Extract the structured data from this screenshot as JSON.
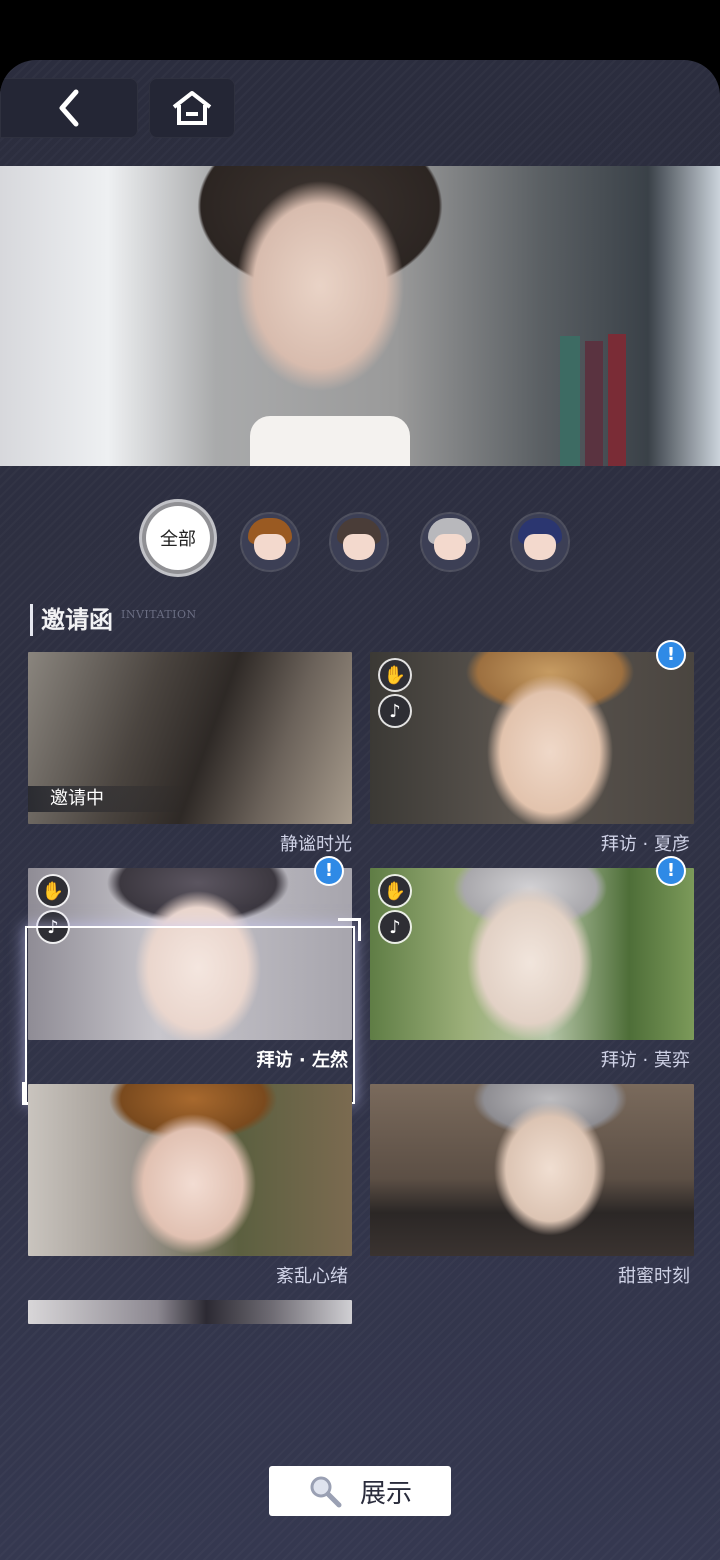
{
  "nav": {
    "back_icon": "chevron-left-icon",
    "home_icon": "home-icon"
  },
  "filters": {
    "all_label": "全部",
    "characters": [
      {
        "name": "character-filter-brown-hair",
        "hair_color": "#9a5a22"
      },
      {
        "name": "character-filter-dark-hair",
        "hair_color": "#4a3d38"
      },
      {
        "name": "character-filter-silver-hair",
        "hair_color": "#b8b8bc"
      },
      {
        "name": "character-filter-navy-hair",
        "hair_color": "#2b3670"
      }
    ]
  },
  "section": {
    "title": "邀请函",
    "subtitle": "INVITATION"
  },
  "cards": [
    {
      "caption": "静谧时光",
      "tag": "邀请中",
      "icons": [],
      "alert": false,
      "selected": false,
      "tone": [
        "#6b6660",
        "#3a3633",
        "#b2a697"
      ]
    },
    {
      "caption": "拜访 · 夏彦",
      "tag": "",
      "icons": [
        "hand-icon",
        "music-note-icon"
      ],
      "alert": true,
      "selected": false,
      "tone": [
        "#4a4540",
        "#c69b62",
        "#e8d3c2"
      ]
    },
    {
      "caption": "拜访 · 左然",
      "tag": "",
      "icons": [
        "hand-icon",
        "music-note-icon"
      ],
      "alert": true,
      "selected": true,
      "tone": [
        "#c8c6cc",
        "#7a7880",
        "#f1ece9"
      ]
    },
    {
      "caption": "拜访 · 莫弈",
      "tag": "",
      "icons": [
        "hand-icon",
        "music-note-icon"
      ],
      "alert": true,
      "selected": false,
      "tone": [
        "#6b8c4a",
        "#b5b4b8",
        "#e4ddd6"
      ]
    },
    {
      "caption": "紊乱心绪",
      "tag": "",
      "icons": [],
      "alert": false,
      "selected": false,
      "tone": [
        "#b8b3ae",
        "#8a5a2a",
        "#5c6040"
      ]
    },
    {
      "caption": "甜蜜时刻",
      "tag": "",
      "icons": [],
      "alert": false,
      "selected": false,
      "tone": [
        "#7a6a5c",
        "#b0aeb0",
        "#2b2726"
      ]
    }
  ],
  "display_button": {
    "label": "展示",
    "icon": "search-icon"
  },
  "colors": {
    "background": "#2e3042",
    "accent_alert": "#2f8ae6",
    "caption": "#cfd2e6"
  }
}
